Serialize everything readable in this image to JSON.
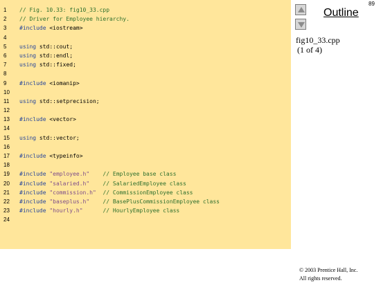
{
  "page": {
    "number": "89"
  },
  "outline": {
    "title": "Outline",
    "file_name": "fig10_33.cpp",
    "page_range": "(1 of 4)"
  },
  "navigation": {
    "up_icon": "triangle-up-icon",
    "down_icon": "triangle-down-icon"
  },
  "code": {
    "lines": [
      {
        "number": "1",
        "segments": [
          {
            "text": "// Fig. 10.33: fig10_33.cpp",
            "type": "comment"
          }
        ]
      },
      {
        "number": "2",
        "segments": [
          {
            "text": "// Driver for Employee hierarchy.",
            "type": "comment"
          }
        ]
      },
      {
        "number": "3",
        "segments": [
          {
            "text": "#include",
            "type": "keyword"
          },
          {
            "text": " <iostream>",
            "type": "text"
          }
        ]
      },
      {
        "number": "4",
        "segments": []
      },
      {
        "number": "5",
        "segments": [
          {
            "text": "using",
            "type": "keyword"
          },
          {
            "text": " std::cout;",
            "type": "text"
          }
        ]
      },
      {
        "number": "6",
        "segments": [
          {
            "text": "using",
            "type": "keyword"
          },
          {
            "text": " std::endl;",
            "type": "text"
          }
        ]
      },
      {
        "number": "7",
        "segments": [
          {
            "text": "using",
            "type": "keyword"
          },
          {
            "text": " std::fixed;",
            "type": "text"
          }
        ]
      },
      {
        "number": "8",
        "segments": []
      },
      {
        "number": "9",
        "segments": [
          {
            "text": "#include",
            "type": "keyword"
          },
          {
            "text": " <iomanip>",
            "type": "text"
          }
        ]
      },
      {
        "number": "10",
        "segments": []
      },
      {
        "number": "11",
        "segments": [
          {
            "text": "using",
            "type": "keyword"
          },
          {
            "text": " std::setprecision;",
            "type": "text"
          }
        ]
      },
      {
        "number": "12",
        "segments": []
      },
      {
        "number": "13",
        "segments": [
          {
            "text": "#include",
            "type": "keyword"
          },
          {
            "text": " <vector>",
            "type": "text"
          }
        ]
      },
      {
        "number": "14",
        "segments": []
      },
      {
        "number": "15",
        "segments": [
          {
            "text": "using",
            "type": "keyword"
          },
          {
            "text": " std::vector;",
            "type": "text"
          }
        ]
      },
      {
        "number": "16",
        "segments": []
      },
      {
        "number": "17",
        "segments": [
          {
            "text": "#include",
            "type": "keyword"
          },
          {
            "text": " <typeinfo>",
            "type": "text"
          }
        ]
      },
      {
        "number": "18",
        "segments": []
      },
      {
        "number": "19",
        "segments": [
          {
            "text": "#include",
            "type": "keyword"
          },
          {
            "text": " ",
            "type": "text"
          },
          {
            "text": "\"employee.h\"",
            "type": "string"
          },
          {
            "text": "    ",
            "type": "text"
          },
          {
            "text": "// Employee base class",
            "type": "comment"
          }
        ]
      },
      {
        "number": "20",
        "segments": [
          {
            "text": "#include",
            "type": "keyword"
          },
          {
            "text": " ",
            "type": "text"
          },
          {
            "text": "\"salaried.h\"",
            "type": "string"
          },
          {
            "text": "    ",
            "type": "text"
          },
          {
            "text": "// SalariedEmployee class",
            "type": "comment"
          }
        ]
      },
      {
        "number": "21",
        "segments": [
          {
            "text": "#include",
            "type": "keyword"
          },
          {
            "text": " ",
            "type": "text"
          },
          {
            "text": "\"commission.h\"",
            "type": "string"
          },
          {
            "text": "  ",
            "type": "text"
          },
          {
            "text": "// CommissionEmployee class",
            "type": "comment"
          }
        ]
      },
      {
        "number": "22",
        "segments": [
          {
            "text": "#include",
            "type": "keyword"
          },
          {
            "text": " ",
            "type": "text"
          },
          {
            "text": "\"baseplus.h\"",
            "type": "string"
          },
          {
            "text": "    ",
            "type": "text"
          },
          {
            "text": "// BasePlusCommissionEmployee class",
            "type": "comment"
          }
        ]
      },
      {
        "number": "23",
        "segments": [
          {
            "text": "#include",
            "type": "keyword"
          },
          {
            "text": " ",
            "type": "text"
          },
          {
            "text": "\"hourly.h\"",
            "type": "string"
          },
          {
            "text": "      ",
            "type": "text"
          },
          {
            "text": "// HourlyEmployee class",
            "type": "comment"
          }
        ]
      },
      {
        "number": "24",
        "segments": []
      }
    ]
  },
  "copyright": {
    "line1": "© 2003 Prentice Hall, Inc.",
    "line2": "All rights reserved."
  },
  "colors": {
    "code_background": "#ffe69b",
    "comment": "#2d6f2d",
    "keyword": "#24449b",
    "string": "#7d4d8a"
  }
}
